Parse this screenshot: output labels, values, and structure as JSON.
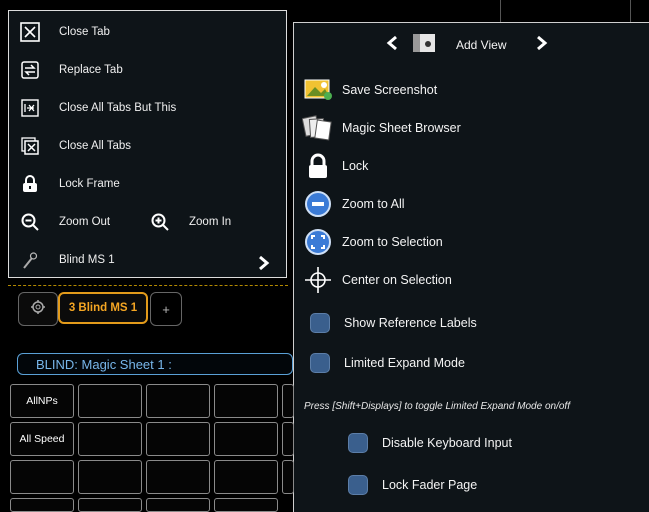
{
  "context_menu": {
    "items": [
      {
        "label": "Close Tab",
        "icon": "close-tab-icon"
      },
      {
        "label": "Replace Tab",
        "icon": "replace-tab-icon"
      },
      {
        "label": "Close All Tabs But This",
        "icon": "close-others-icon"
      },
      {
        "label": "Close All Tabs",
        "icon": "close-all-tabs-icon"
      },
      {
        "label": "Lock Frame",
        "icon": "lock-icon"
      },
      {
        "label": "Zoom Out",
        "icon": "zoom-out-icon"
      },
      {
        "label": "Zoom In",
        "icon": "zoom-in-icon"
      },
      {
        "label": "Blind MS 1",
        "icon": "magic-wand-icon"
      }
    ]
  },
  "view_menu": {
    "add_view_label": "Add View",
    "items": [
      {
        "label": "Save Screenshot",
        "icon": "screenshot-icon"
      },
      {
        "label": "Magic Sheet Browser",
        "icon": "magic-sheet-icon"
      },
      {
        "label": "Lock",
        "icon": "lock-icon"
      },
      {
        "label": "Zoom to All",
        "icon": "zoom-to-all-icon"
      },
      {
        "label": "Zoom to Selection",
        "icon": "zoom-to-selection-icon"
      },
      {
        "label": "Center on Selection",
        "icon": "crosshair-icon"
      }
    ],
    "toggles": [
      {
        "label": "Show Reference Labels"
      },
      {
        "label": "Limited Expand Mode"
      }
    ],
    "hint": "Press [Shift+Displays] to toggle Limited Expand Mode on/off",
    "extra_toggles": [
      {
        "label": "Disable Keyboard Input"
      },
      {
        "label": "Lock Fader Page"
      }
    ]
  },
  "tabs": {
    "active_label": "3 Blind MS 1",
    "add_label": "+"
  },
  "blind_bar": "BLIND: Magic Sheet  1 :",
  "grid": {
    "row1_first": "AllNPs",
    "row2_first": "All Speed"
  },
  "colors": {
    "accent_orange": "#e39b1b",
    "blind_blue": "#78b6ea",
    "toggle_blue": "#3a5f8d"
  }
}
